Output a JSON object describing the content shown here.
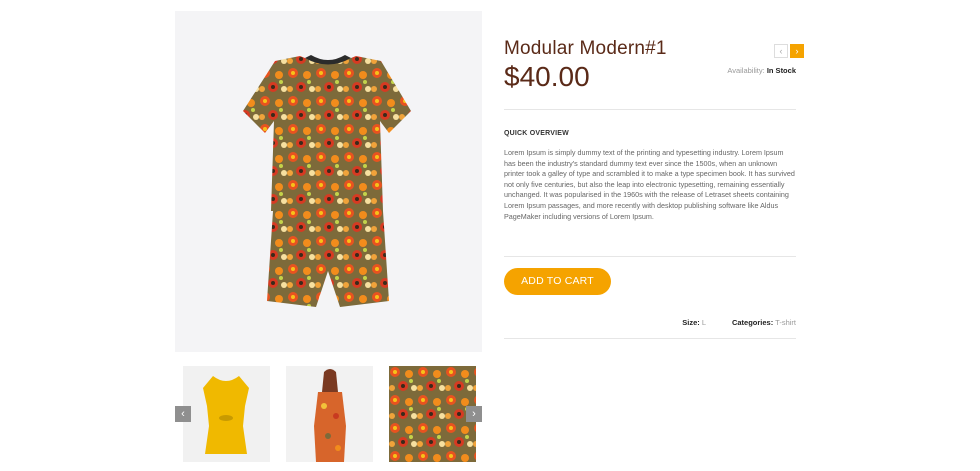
{
  "product": {
    "title": "Modular Modern#1",
    "price": "$40.00",
    "availability_label": "Availability:",
    "availability_value": "In Stock",
    "overview_title": "QUICK OVERVIEW",
    "overview_text": "Lorem Ipsum is simply dummy text of the printing and typesetting industry. Lorem Ipsum has been the industry's standard dummy text ever since the 1500s, when an unknown printer took a galley of type and scrambled it to make a type specimen book. It has survived not only five centuries, but also the leap into electronic typesetting, remaining essentially unchanged. It was popularised in the 1960s with the release of Letraset sheets containing Lorem Ipsum passages, and more recently with desktop publishing software like Aldus PageMaker including versions of Lorem Ipsum.",
    "add_to_cart": "ADD TO CART",
    "size_label": "Size:",
    "size_value": "L",
    "categories_label": "Categories:",
    "categories_value": "T-shirt"
  },
  "nav": {
    "prev_icon": "‹",
    "next_icon": "›"
  },
  "thumbs": {
    "prev_icon": "‹",
    "next_icon": "›"
  },
  "colors": {
    "accent": "#f5a300",
    "title": "#5a2a18"
  }
}
